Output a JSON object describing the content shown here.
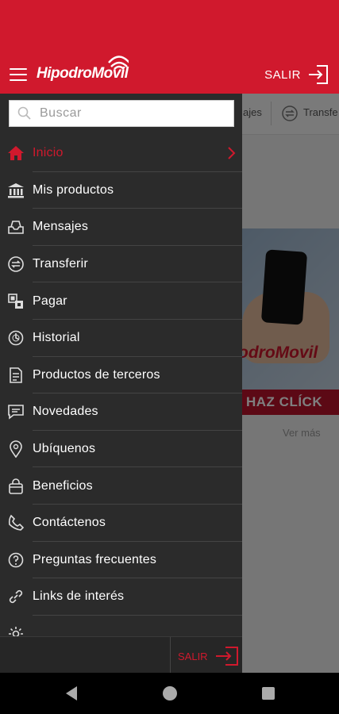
{
  "header": {
    "logo_part1": "Hipodro",
    "logo_part2": "Movil",
    "logout_label": "SALIR"
  },
  "background": {
    "quickbar": {
      "item_left": "ajes",
      "item_right": "Transfe"
    },
    "banner": {
      "logo_part1": "odro",
      "logo_part2": "Movil",
      "cta": "HAZ CLÍCK"
    },
    "more_link": "Ver más"
  },
  "drawer": {
    "search_placeholder": "Buscar",
    "items": [
      {
        "label": "Inicio",
        "icon": "home-icon",
        "active": true
      },
      {
        "label": "Mis productos",
        "icon": "bank-icon"
      },
      {
        "label": "Mensajes",
        "icon": "inbox-icon"
      },
      {
        "label": "Transferir",
        "icon": "transfer-icon"
      },
      {
        "label": "Pagar",
        "icon": "pay-icon"
      },
      {
        "label": "Historial",
        "icon": "history-icon"
      },
      {
        "label": "Productos de terceros",
        "icon": "third-party-icon"
      },
      {
        "label": "Novedades",
        "icon": "chat-icon"
      },
      {
        "label": "Ubíquenos",
        "icon": "location-pin-icon"
      },
      {
        "label": "Beneficios",
        "icon": "bag-icon"
      },
      {
        "label": "Contáctenos",
        "icon": "phone-icon"
      },
      {
        "label": "Preguntas frecuentes",
        "icon": "help-icon"
      },
      {
        "label": "Links de interés",
        "icon": "link-icon"
      },
      {
        "label": "",
        "icon": "settings-icon"
      }
    ],
    "footer_logout_label": "SALIR"
  },
  "colors": {
    "brand_red": "#d0192d",
    "drawer_bg": "#2b2b2b"
  }
}
